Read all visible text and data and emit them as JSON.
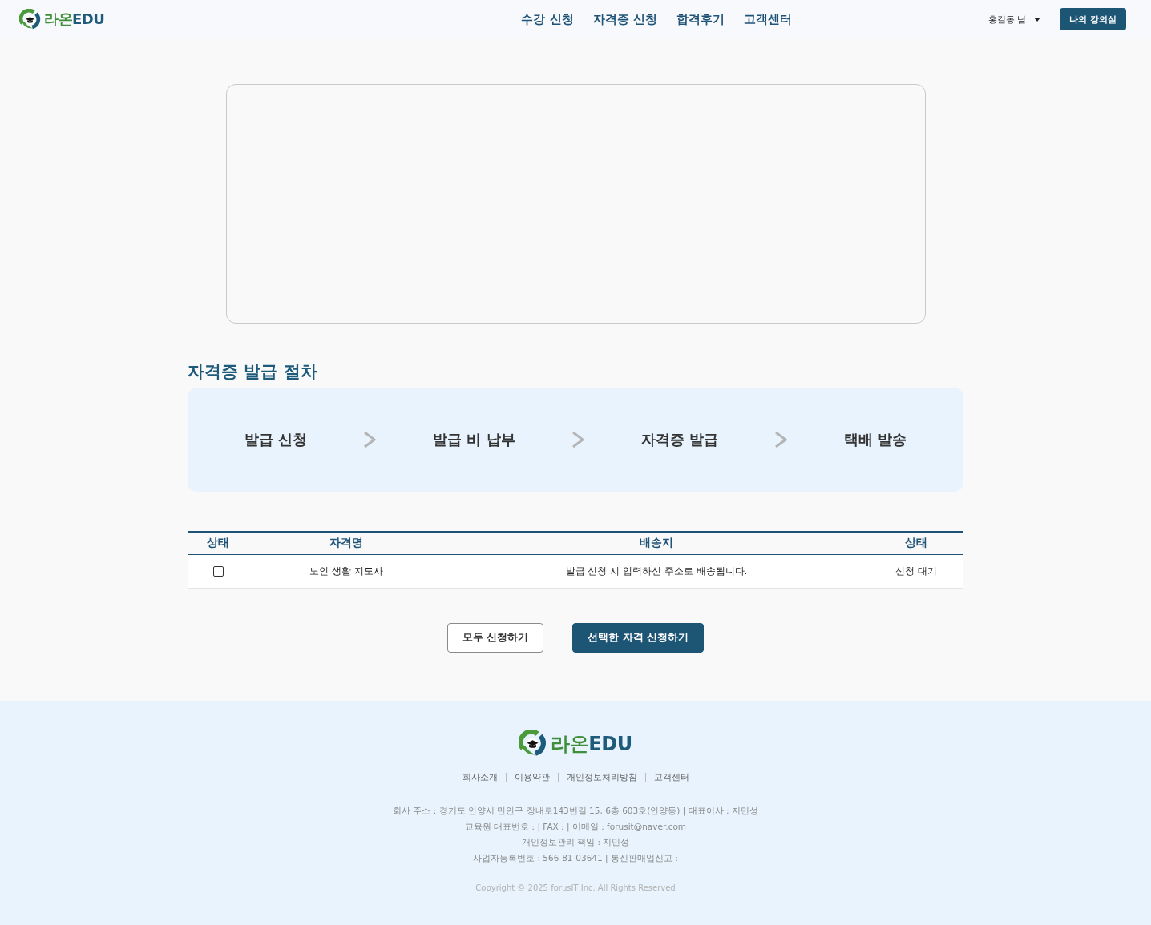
{
  "header": {
    "logo": {
      "ko": "라온",
      "en": "EDU"
    },
    "nav": [
      "수강 신청",
      "자격증 신청",
      "합격후기",
      "고객센터"
    ],
    "user": "홍길동 님",
    "classroom_button": "나의 강의실"
  },
  "procedure": {
    "title": "자격증 발급 절차",
    "steps": [
      "발급 신청",
      "발급 비 납부",
      "자격증 발급",
      "택배 발송"
    ]
  },
  "table": {
    "columns": [
      "상태",
      "자격명",
      "배송지",
      "상태"
    ],
    "rows": [
      {
        "cells": [
          {
            "kind": "checkbox",
            "checked": false
          },
          {
            "kind": "text",
            "text": "노인 생활 지도사"
          },
          {
            "kind": "text",
            "text": "발급 신청 시 입력하신 주소로 배송됩니다."
          },
          {
            "kind": "text",
            "text": "신청 대기"
          }
        ]
      }
    ]
  },
  "actions": [
    {
      "kind": "outline",
      "label": "모두 신청하기"
    },
    {
      "kind": "primary",
      "label": "선택한 자격 신청하기"
    }
  ],
  "footer": {
    "logo": {
      "ko": "라온",
      "en": "EDU"
    },
    "links": [
      "회사소개",
      "이용약관",
      "개인정보처리방침",
      "고객센터"
    ],
    "info": [
      "회사 주소 : 경기도 안양시 만안구 장내로143번길 15, 6층 603호(안양동) | 대표이사 : 지민성",
      "교육원 대표번호 : | FAX : | 이메일 : forusit@naver.com",
      "개인정보관리 책임 : 지민성",
      "사업자등록번호 : 566-81-03641 | 통신판매업신고 :"
    ],
    "copyright": "Copyright © 2025 forusIT Inc. All Rights Reserved"
  }
}
